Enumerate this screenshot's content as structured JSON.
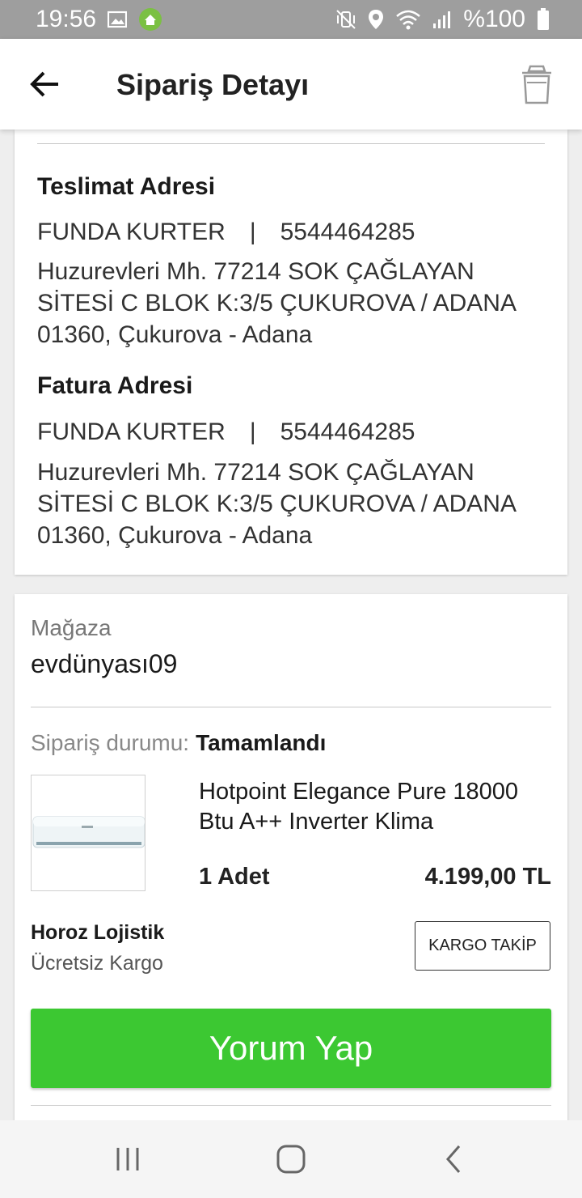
{
  "status_bar": {
    "time": "19:56",
    "battery": "%100",
    "icons": [
      "image-icon",
      "app-notification-icon",
      "mute-vibrate-icon",
      "location-icon",
      "wifi-icon",
      "signal-icon",
      "battery-icon"
    ]
  },
  "app_bar": {
    "title": "Sipariş Detayı",
    "back_icon": "arrow-left-icon",
    "trash_icon": "trash-icon"
  },
  "delivery_address": {
    "title": "Teslimat Adresi",
    "name": "FUNDA KURTER",
    "separator": "|",
    "phone": "5544464285",
    "address": "Huzurevleri Mh.  77214 SOK ÇAĞLAYAN SİTESİ  C BLOK K:3/5    ÇUKUROVA / ADANA 01360, Çukurova - Adana"
  },
  "billing_address": {
    "title": "Fatura Adresi",
    "name": "FUNDA KURTER",
    "separator": "|",
    "phone": "5544464285",
    "address": "Huzurevleri Mh.  77214 SOK ÇAĞLAYAN SİTESİ  C BLOK K:3/5    ÇUKUROVA / ADANA 01360, Çukurova - Adana"
  },
  "store": {
    "label": "Mağaza",
    "name": "evdünyası09"
  },
  "order": {
    "status_label": "Sipariş durumu:",
    "status_value": "Tamamlandı",
    "product_name": "Hotpoint Elegance Pure 18000 Btu A++ Inverter Klima",
    "quantity": "1 Adet",
    "price": "4.199,00 TL",
    "shipping_company": "Horoz Lojistik",
    "shipping_note": "Ücretsiz Kargo",
    "track_button": "KARGO TAKİP",
    "review_button": "Yorum Yap"
  },
  "colors": {
    "status_bar_bg": "#9e9e9e",
    "review_button_bg": "#3cc832"
  },
  "nav_bar": {
    "icons": [
      "recent-apps-icon",
      "home-icon",
      "back-icon"
    ]
  }
}
